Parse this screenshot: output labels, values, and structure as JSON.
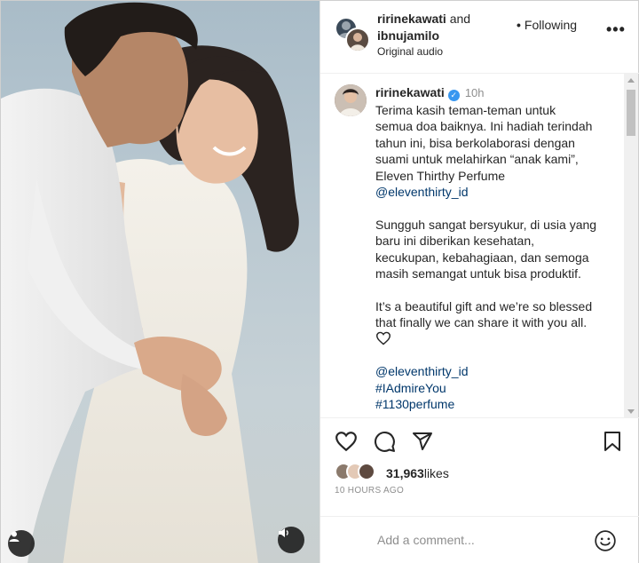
{
  "header": {
    "user1": "ririnekawati",
    "and_text": " and",
    "user2": "ibnujamilo",
    "audio": "Original audio",
    "follow_label": "Following",
    "more_label": "•••"
  },
  "caption": {
    "username": "ririnekawati",
    "verified_mark": "✓",
    "time": "10h",
    "para1": [
      "Terima kasih teman-teman untuk",
      "semua doa baiknya. Ini hadiah terindah",
      "tahun ini, bisa berkolaborasi dengan",
      "suami untuk melahirkan “anak kami”,",
      "Eleven Thirthy Perfume"
    ],
    "mention1": "@eleventhirty_id",
    "para2": [
      "Sungguh sangat bersyukur, di usia yang",
      "baru ini diberikan kesehatan,",
      "kecukupan, kebahagiaan, dan semoga",
      "masih semangat untuk bisa produktif."
    ],
    "para3": [
      "It’s a beautiful gift and we’re so blessed",
      "that finally we can share it with you all."
    ],
    "mention2": "@eleventhirty_id",
    "hashtag1": "#IAdmireYou",
    "hashtag2": "#1130perfume"
  },
  "likes": {
    "count": "31,963",
    "suffix": "likes"
  },
  "time_ago": "10 HOURS AGO",
  "comment": {
    "placeholder": "Add a comment..."
  },
  "colors": {
    "link": "#00376b",
    "muted": "#8e8e8e",
    "verified": "#3897f0"
  }
}
